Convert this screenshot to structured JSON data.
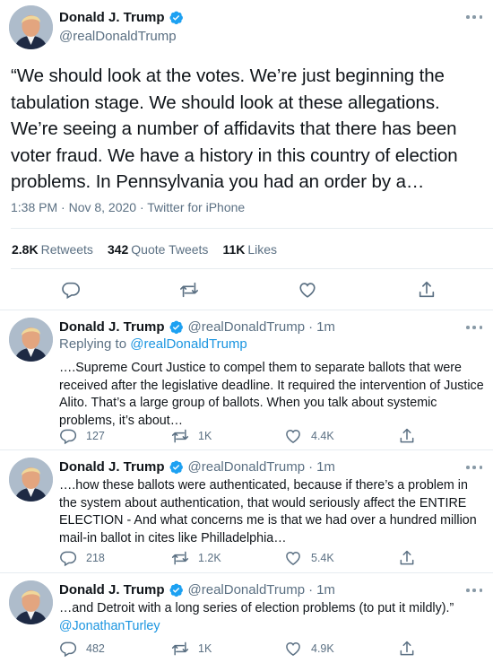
{
  "colors": {
    "accent": "#1b95e0",
    "muted": "#5b7083",
    "text": "#0f1419",
    "border": "#e6ecf0"
  },
  "main_tweet": {
    "name": "Donald J. Trump",
    "handle": "@realDonaldTrump",
    "verified": true,
    "text": "“We should look at the votes. We’re just beginning the tabulation stage. We should look at these allegations. We’re seeing a number of affidavits that there has been voter fraud. We have a history in this country of election problems. In Pennsylvania you had an order by a…",
    "meta": "1:38 PM · Nov 8, 2020 · Twitter for iPhone",
    "stats": {
      "retweets_count": "2.8K",
      "retweets_label": "Retweets",
      "quotes_count": "342",
      "quotes_label": "Quote Tweets",
      "likes_count": "11K",
      "likes_label": "Likes"
    },
    "icons": [
      "reply-icon",
      "retweet-icon",
      "like-icon",
      "share-icon"
    ]
  },
  "replies": [
    {
      "name": "Donald J. Trump",
      "handle": "@realDonaldTrump",
      "separator": "·",
      "time": "1m",
      "replying_prefix": "Replying to",
      "replying_to": "@realDonaldTrump",
      "text": "….Supreme Court Justice to compel them to separate ballots that were received after the legislative deadline. It required the intervention of Justice Alito. That’s a large group of ballots. When you talk about systemic problems, it’s about…",
      "replies": "127",
      "retweets": "1K",
      "likes": "4.4K"
    },
    {
      "name": "Donald J. Trump",
      "handle": "@realDonaldTrump",
      "separator": "·",
      "time": "1m",
      "text": "….how these ballots were authenticated, because if there’s a problem in the system about authentication, that would seriously affect the ENTIRE ELECTION - And what concerns me is that we had over a hundred million mail-in ballot in cites like Philladelphia…",
      "replies": "218",
      "retweets": "1.2K",
      "likes": "5.4K"
    },
    {
      "name": "Donald J. Trump",
      "handle": "@realDonaldTrump",
      "separator": "·",
      "time": "1m",
      "text": "…and Detroit with a long series of election problems (to put it mildly).”",
      "mention": "@JonathanTurley",
      "replies": "482",
      "retweets": "1K",
      "likes": "4.9K"
    }
  ]
}
